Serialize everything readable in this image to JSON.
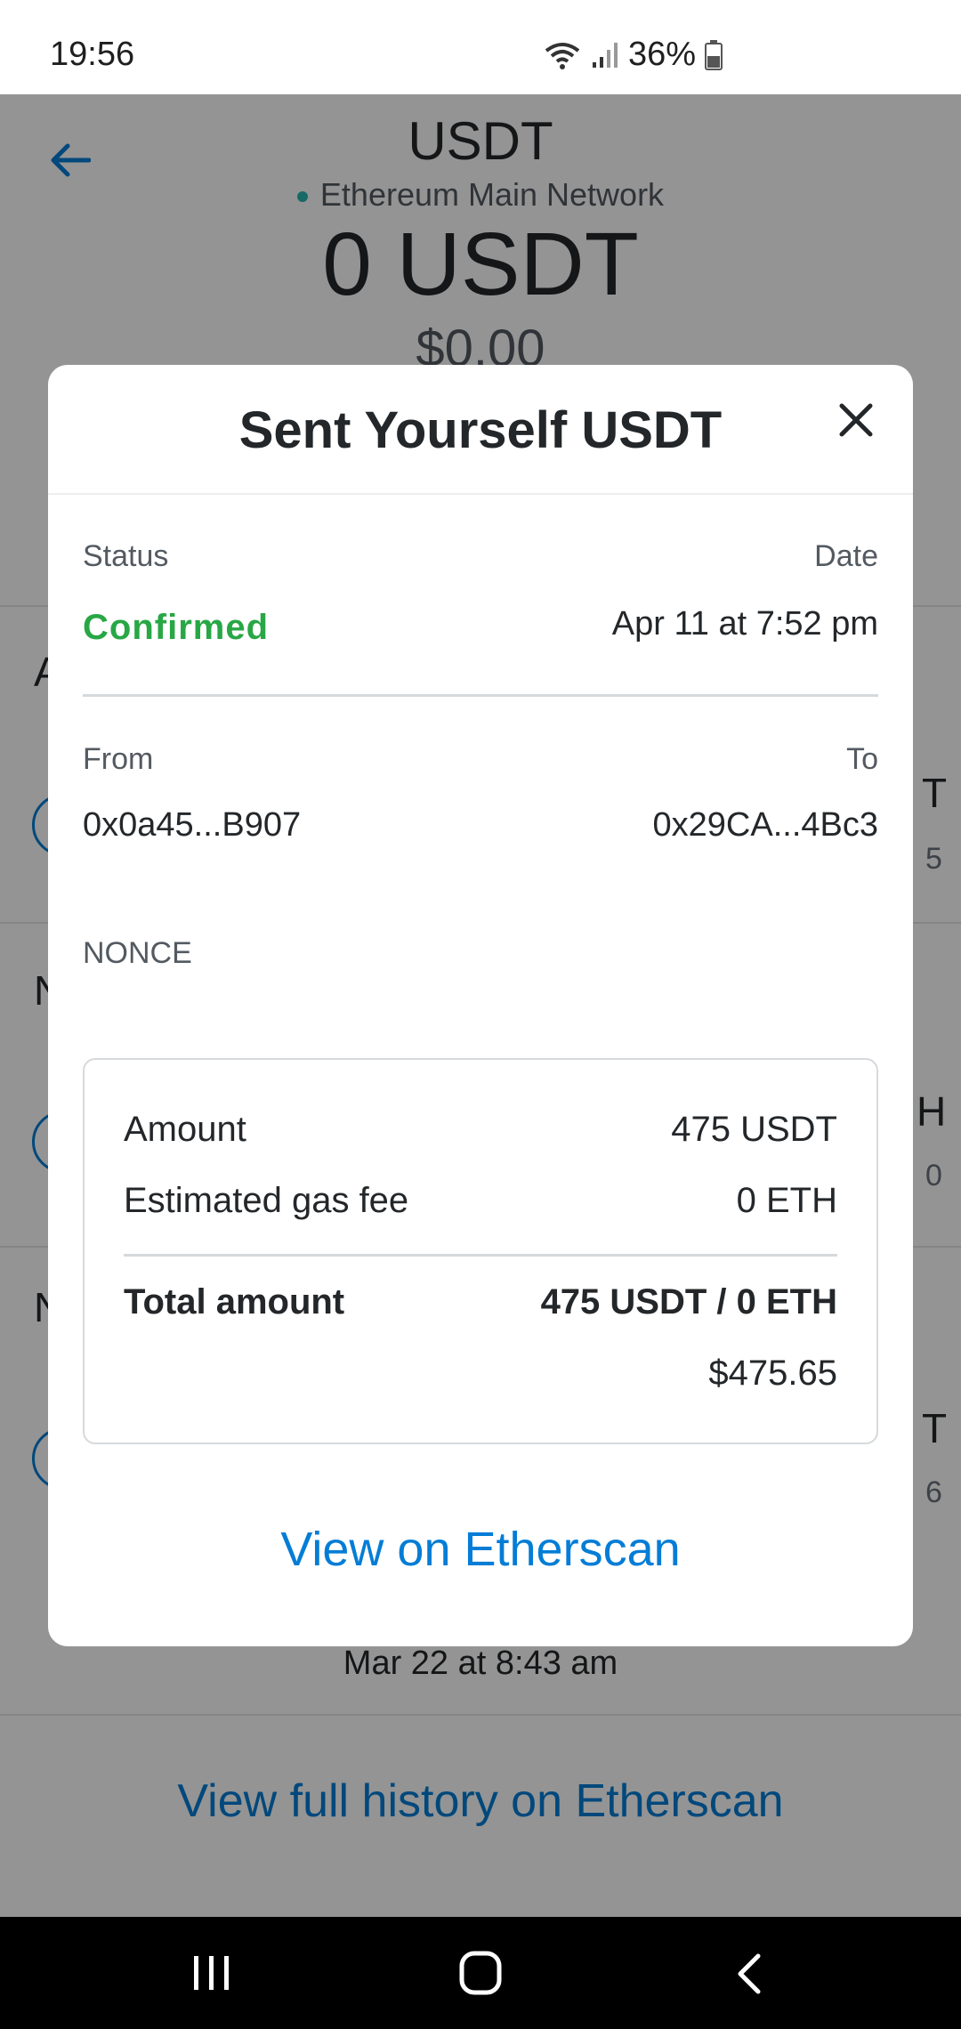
{
  "status_bar": {
    "time": "19:56",
    "battery": "36%"
  },
  "background": {
    "asset_title": "USDT",
    "network": "Ethereum Main Network",
    "balance": "0 USDT",
    "fiat_balance": "$0.00",
    "last_tx_date": "Mar 22 at 8:43 am",
    "view_full_history": "View full history on Etherscan"
  },
  "modal": {
    "title": "Sent Yourself USDT",
    "status_label": "Status",
    "status_value": "Confirmed",
    "date_label": "Date",
    "date_value": "Apr 11 at 7:52 pm",
    "from_label": "From",
    "from_value": "0x0a45...B907",
    "to_label": "To",
    "to_value": "0x29CA...4Bc3",
    "nonce_label": "NONCE",
    "summary": {
      "amount_label": "Amount",
      "amount_value": "475 USDT",
      "gas_label": "Estimated gas fee",
      "gas_value": "0 ETH",
      "total_label": "Total amount",
      "total_value": "475 USDT / 0 ETH",
      "total_fiat": "$475.65"
    },
    "etherscan_link": "View on Etherscan"
  },
  "colors": {
    "accent": "#037dd6",
    "confirmed": "#28a745",
    "network_dot": "#29b6af"
  },
  "icons": [
    "wifi-icon",
    "signal-icon",
    "battery-icon",
    "back-arrow-icon",
    "close-icon",
    "recents-icon",
    "home-icon",
    "back-icon"
  ]
}
